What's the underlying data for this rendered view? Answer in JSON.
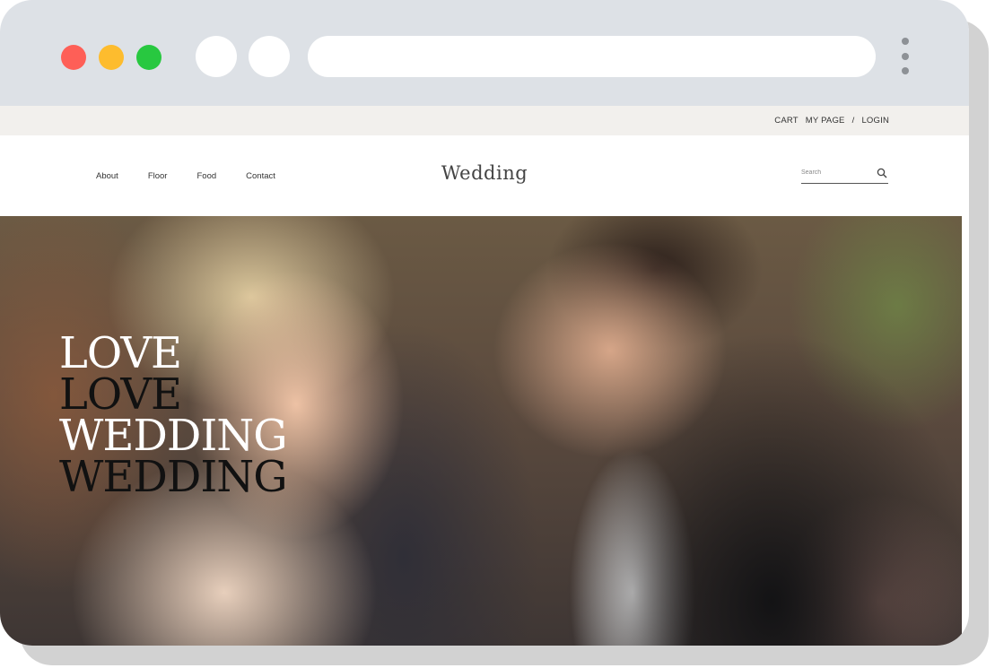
{
  "browser": {
    "traffic_lights": {
      "close": "#fe5f57",
      "minimize": "#fdbc2e",
      "maximize": "#28c840"
    },
    "chrome_color": "#dde1e6",
    "address": ""
  },
  "topbar": {
    "cart": "CART",
    "my_page": "MY PAGE",
    "separator": "/",
    "login": "LOGIN"
  },
  "header": {
    "nav": [
      "About",
      "Floor",
      "Food",
      "Contact"
    ],
    "logo": "Wedding",
    "search_placeholder": "Search",
    "search_icon": "search-icon"
  },
  "hero": {
    "lines": [
      "LOVE",
      "LOVE",
      "WEDDING",
      "WEDDING"
    ]
  }
}
